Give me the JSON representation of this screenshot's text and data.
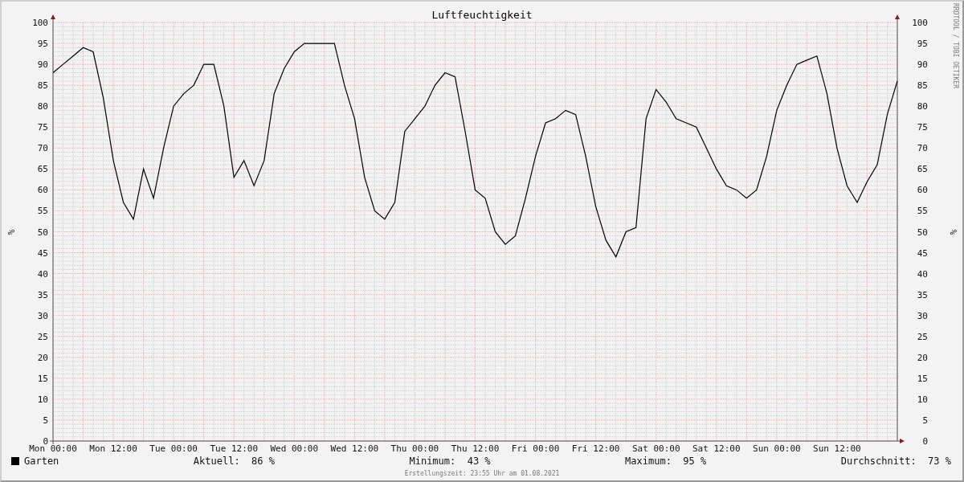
{
  "graph": {
    "credit": "RRDTOOL / TOBI OETIKER",
    "chart_data": {
      "type": "line",
      "title": "Luftfeuchtigkeit",
      "ylabel": "%",
      "y2label": "%",
      "grid": true,
      "ylim": [
        0,
        100
      ],
      "y2lim": [
        0,
        100
      ],
      "categories": [
        "Mon 00:00",
        null,
        null,
        null,
        null,
        null,
        "Mon 12:00",
        null,
        null,
        null,
        null,
        null,
        "Tue 00:00",
        null,
        null,
        null,
        null,
        null,
        "Tue 12:00",
        null,
        null,
        null,
        null,
        null,
        "Wed 00:00",
        null,
        null,
        null,
        null,
        null,
        "Wed 12:00",
        null,
        null,
        null,
        null,
        null,
        "Thu 00:00",
        null,
        null,
        null,
        null,
        null,
        "Thu 12:00",
        null,
        null,
        null,
        null,
        null,
        "Fri 00:00",
        null,
        null,
        null,
        null,
        null,
        "Fri 12:00",
        null,
        null,
        null,
        null,
        null,
        "Sat 00:00",
        null,
        null,
        null,
        null,
        null,
        "Sat 12:00",
        null,
        null,
        null,
        null,
        null,
        "Sun 00:00",
        null,
        null,
        null,
        null,
        null,
        "Sun 12:00",
        null,
        null,
        null,
        null,
        null,
        null
      ],
      "series": [
        {
          "name": "Garten",
          "color": "#000000",
          "values": [
            88,
            90,
            92,
            94,
            93,
            82,
            67,
            57,
            53,
            65,
            58,
            70,
            80,
            83,
            85,
            90,
            90,
            80,
            63,
            67,
            61,
            67,
            83,
            89,
            93,
            95,
            95,
            95,
            95,
            85,
            77,
            63,
            55,
            53,
            57,
            74,
            77,
            80,
            85,
            88,
            87,
            74,
            60,
            58,
            50,
            47,
            49,
            58,
            68,
            76,
            77,
            79,
            78,
            68,
            56,
            48,
            44,
            50,
            51,
            77,
            84,
            81,
            77,
            76,
            75,
            70,
            65,
            61,
            60,
            58,
            60,
            68,
            79,
            85,
            90,
            91,
            92,
            83,
            70,
            61,
            57,
            62,
            66,
            78,
            86
          ]
        }
      ],
      "yticks": [
        0,
        5,
        10,
        15,
        20,
        25,
        30,
        35,
        40,
        45,
        50,
        55,
        60,
        65,
        70,
        75,
        80,
        85,
        90,
        95,
        100
      ],
      "y2ticks": [
        0,
        5,
        10,
        15,
        20,
        25,
        30,
        35,
        40,
        45,
        50,
        55,
        60,
        65,
        70,
        75,
        80,
        85,
        90,
        95,
        100
      ]
    },
    "legend": {
      "stats": [
        {
          "label": "Aktuell:",
          "value": "86 %"
        },
        {
          "label": "Minimum:",
          "value": "43 %"
        },
        {
          "label": "Maximum:",
          "value": "95 %"
        },
        {
          "label": "Durchschnitt:",
          "value": "73 %"
        }
      ]
    },
    "footer": "Erstellungszeit: 23:55 Uhr am 01.08.2021"
  }
}
